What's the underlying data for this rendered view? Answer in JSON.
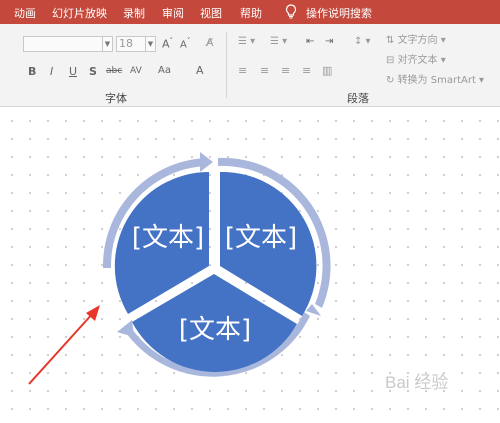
{
  "tabs": [
    "动画",
    "幻灯片放映",
    "录制",
    "审阅",
    "视图",
    "帮助"
  ],
  "search": {
    "label": "操作说明搜索",
    "icon": "lightbulb-icon"
  },
  "font_group": {
    "label": "字体",
    "font_size": "18",
    "buttons": [
      "B",
      "I",
      "U",
      "S",
      "abc",
      "AV",
      "Aa",
      "A"
    ]
  },
  "paragraph_group": {
    "label": "段落",
    "text_direction": "文字方向",
    "align_text": "对齐文本",
    "convert_smartart": "转换为 SmartArt"
  },
  "diagram": {
    "segments": [
      "[文本]",
      "[文本]",
      "[文本]"
    ],
    "fill_color": "#4472c4",
    "arrow_color": "#a9b7dd"
  },
  "annotation": {
    "color": "#e8362a"
  },
  "watermark": "Bai 经验"
}
